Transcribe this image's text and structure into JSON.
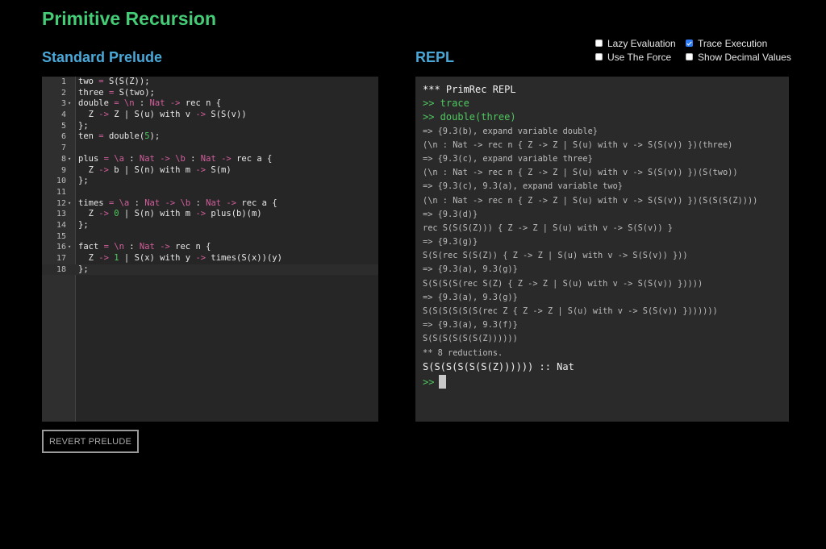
{
  "title": "Primitive Recursion",
  "prelude_title": "Standard Prelude",
  "repl_title": "REPL",
  "options": [
    {
      "label": "Lazy Evaluation",
      "checked": false
    },
    {
      "label": "Trace Execution",
      "checked": true
    },
    {
      "label": "Use The Force",
      "checked": false
    },
    {
      "label": "Show Decimal Values",
      "checked": false
    }
  ],
  "editor": {
    "lines": [
      {
        "num": "1",
        "fold": "",
        "text": "two = S(S(Z));"
      },
      {
        "num": "2",
        "fold": "",
        "text": "three = S(two);"
      },
      {
        "num": "3",
        "fold": "▾",
        "text": "double = \\n : Nat -> rec n {"
      },
      {
        "num": "4",
        "fold": "",
        "text": "  Z -> Z | S(u) with v -> S(S(v))"
      },
      {
        "num": "5",
        "fold": "",
        "text": "};"
      },
      {
        "num": "6",
        "fold": "",
        "text": "ten = double(5);"
      },
      {
        "num": "7",
        "fold": "",
        "text": ""
      },
      {
        "num": "8",
        "fold": "▾",
        "text": "plus = \\a : Nat -> \\b : Nat -> rec a {"
      },
      {
        "num": "9",
        "fold": "",
        "text": "  Z -> b | S(n) with m -> S(m)"
      },
      {
        "num": "10",
        "fold": "",
        "text": "};"
      },
      {
        "num": "11",
        "fold": "",
        "text": ""
      },
      {
        "num": "12",
        "fold": "▾",
        "text": "times = \\a : Nat -> \\b : Nat -> rec a {"
      },
      {
        "num": "13",
        "fold": "",
        "text": "  Z -> 0 | S(n) with m -> plus(b)(m)"
      },
      {
        "num": "14",
        "fold": "",
        "text": "};"
      },
      {
        "num": "15",
        "fold": "",
        "text": ""
      },
      {
        "num": "16",
        "fold": "▾",
        "text": "fact = \\n : Nat -> rec n {"
      },
      {
        "num": "17",
        "fold": "",
        "text": "  Z -> 1 | S(x) with y -> times(S(x))(y)"
      },
      {
        "num": "18",
        "fold": "",
        "text": "};"
      }
    ]
  },
  "revert_label": "REVERT PRELUDE",
  "repl": {
    "lines": [
      {
        "kind": "hdr",
        "text": "*** PrimRec REPL"
      },
      {
        "kind": "cmd",
        "text": ">> trace"
      },
      {
        "kind": "cmd",
        "text": ">> double(three)"
      },
      {
        "kind": "out",
        "text": "=> {9.3(b), expand variable double}"
      },
      {
        "kind": "out",
        "text": "(\\n : Nat -> rec n { Z -> Z | S(u) with v -> S(S(v)) })(three)"
      },
      {
        "kind": "out",
        "text": "=> {9.3(c), expand variable three}"
      },
      {
        "kind": "out",
        "text": "(\\n : Nat -> rec n { Z -> Z | S(u) with v -> S(S(v)) })(S(two))"
      },
      {
        "kind": "out",
        "text": "=> {9.3(c), 9.3(a), expand variable two}"
      },
      {
        "kind": "out",
        "text": "(\\n : Nat -> rec n { Z -> Z | S(u) with v -> S(S(v)) })(S(S(S(Z))))"
      },
      {
        "kind": "out",
        "text": "=> {9.3(d)}"
      },
      {
        "kind": "out",
        "text": "rec S(S(S(Z))) { Z -> Z | S(u) with v -> S(S(v)) }"
      },
      {
        "kind": "out",
        "text": "=> {9.3(g)}"
      },
      {
        "kind": "out",
        "text": "S(S(rec S(S(Z)) { Z -> Z | S(u) with v -> S(S(v)) }))"
      },
      {
        "kind": "out",
        "text": "=> {9.3(a), 9.3(g)}"
      },
      {
        "kind": "out",
        "text": "S(S(S(S(rec S(Z) { Z -> Z | S(u) with v -> S(S(v)) }))))"
      },
      {
        "kind": "out",
        "text": "=> {9.3(a), 9.3(g)}"
      },
      {
        "kind": "out",
        "text": "S(S(S(S(S(S(rec Z { Z -> Z | S(u) with v -> S(S(v)) }))))))"
      },
      {
        "kind": "out",
        "text": "=> {9.3(a), 9.3(f)}"
      },
      {
        "kind": "out",
        "text": "S(S(S(S(S(S(Z))))))"
      },
      {
        "kind": "out",
        "text": "** 8 reductions."
      },
      {
        "kind": "res",
        "text": "S(S(S(S(S(S(Z)))))) :: Nat"
      }
    ],
    "prompt": ">>"
  }
}
